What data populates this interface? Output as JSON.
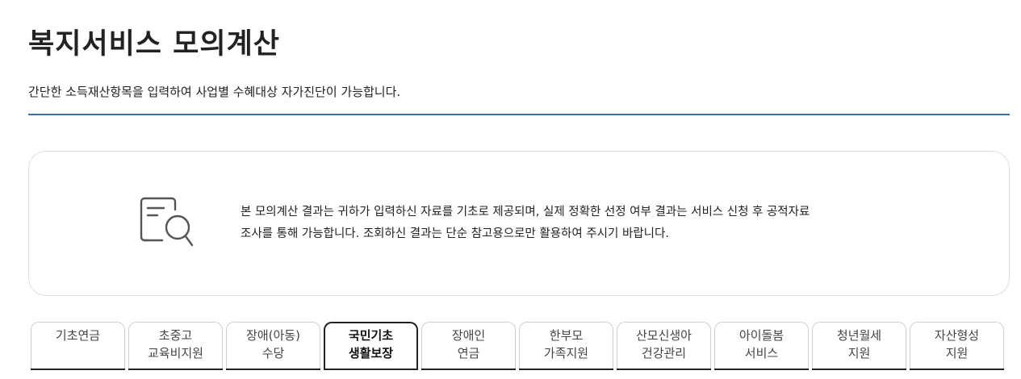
{
  "page": {
    "title": "복지서비스 모의계산",
    "description": "간단한 소득재산항목을 입력하여 사업별 수혜대상 자가진단이 가능합니다."
  },
  "notice": {
    "icon": "document-search-icon",
    "line1": "본 모의계산 결과는 귀하가 입력하신 자료를 기초로 제공되며, 실제 정확한 선정 여부 결과는 서비스 신청 후 공적자료",
    "line2": "조사를 통해 가능합니다. 조회하신 결과는 단순 참고용으로만 활용하여 주시기 바랍니다."
  },
  "tabs": [
    {
      "line1": "기초연금",
      "line2": ""
    },
    {
      "line1": "초중고",
      "line2": "교육비지원"
    },
    {
      "line1": "장애(아동)",
      "line2": "수당"
    },
    {
      "line1": "국민기초",
      "line2": "생활보장",
      "active": true
    },
    {
      "line1": "장애인",
      "line2": "연금"
    },
    {
      "line1": "한부모",
      "line2": "가족지원"
    },
    {
      "line1": "산모신생아",
      "line2": "건강관리"
    },
    {
      "line1": "아이돌봄",
      "line2": "서비스"
    },
    {
      "line1": "청년월세",
      "line2": "지원"
    },
    {
      "line1": "자산형성",
      "line2": "지원"
    }
  ],
  "colors": {
    "accent_rule": "#3a6fb0",
    "active_tab_border": "#222222"
  }
}
